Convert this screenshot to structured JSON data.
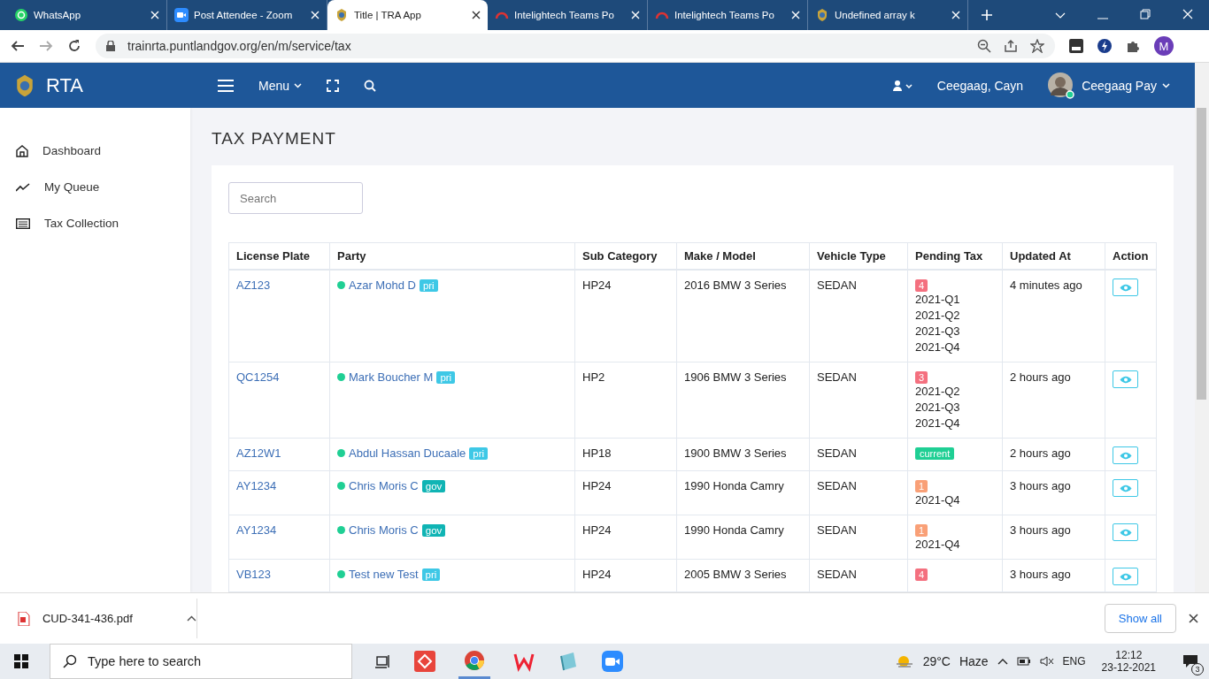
{
  "browser": {
    "tabs": [
      {
        "title": "WhatsApp",
        "kind": "chat",
        "selected": false
      },
      {
        "title": "Post Attendee - Zoom",
        "kind": "camera",
        "selected": false
      },
      {
        "title": "Title | TRA App",
        "kind": "emblem",
        "selected": true
      },
      {
        "title": "Intelightech Teams Po",
        "kind": "headset",
        "selected": false
      },
      {
        "title": "Intelightech Teams Po",
        "kind": "headset",
        "selected": false
      },
      {
        "title": "Undefined array k",
        "kind": "emblem",
        "selected": false
      }
    ],
    "url": "trainrta.puntlandgov.org/en/m/service/tax",
    "profile_initial": "M"
  },
  "header": {
    "brand": "RTA",
    "menu_label": "Menu",
    "user_name": "Ceegaag, Cayn",
    "account_name": "Ceegaag Pay"
  },
  "sidebar": {
    "items": [
      {
        "label": "Dashboard"
      },
      {
        "label": "My Queue"
      },
      {
        "label": "Tax Collection"
      }
    ]
  },
  "page": {
    "title": "TAX PAYMENT",
    "search": {
      "placeholder": "Search"
    }
  },
  "table": {
    "columns": [
      "License Plate",
      "Party",
      "Sub Category",
      "Make / Model",
      "Vehicle Type",
      "Pending Tax",
      "Updated At",
      "Action"
    ],
    "rows": [
      {
        "plate": "AZ123",
        "party": "Azar Mohd D",
        "tag": {
          "text": "pri",
          "color": "#3ec8e6"
        },
        "sub_category": "HP24",
        "make_model": "2016 BMW 3 Series",
        "vehicle_type": "SEDAN",
        "pending": {
          "kind": "count",
          "text": "4",
          "color": "#f4707f"
        },
        "quarters": [
          "2021-Q1",
          "2021-Q2",
          "2021-Q3",
          "2021-Q4"
        ],
        "updated": "4 minutes ago"
      },
      {
        "plate": "QC1254",
        "party": "Mark Boucher M",
        "tag": {
          "text": "pri",
          "color": "#3ec8e6"
        },
        "sub_category": "HP2",
        "make_model": "1906 BMW 3 Series",
        "vehicle_type": "SEDAN",
        "pending": {
          "kind": "count",
          "text": "3",
          "color": "#f4707f"
        },
        "quarters": [
          "2021-Q2",
          "2021-Q3",
          "2021-Q4"
        ],
        "updated": "2 hours ago"
      },
      {
        "plate": "AZ12W1",
        "party": "Abdul Hassan Ducaale",
        "tag": {
          "text": "pri",
          "color": "#3ec8e6"
        },
        "sub_category": "HP18",
        "make_model": "1900 BMW 3 Series",
        "vehicle_type": "SEDAN",
        "pending": {
          "kind": "status",
          "text": "current",
          "color": "#1fcf94"
        },
        "quarters": [],
        "updated": "2 hours ago"
      },
      {
        "plate": "AY1234",
        "party": "Chris Moris C",
        "tag": {
          "text": "gov",
          "color": "#10b4b4"
        },
        "sub_category": "HP24",
        "make_model": "1990 Honda Camry",
        "vehicle_type": "SEDAN",
        "pending": {
          "kind": "count",
          "text": "1",
          "color": "#f9a077"
        },
        "quarters": [
          "2021-Q4"
        ],
        "updated": "3 hours ago"
      },
      {
        "plate": "AY1234",
        "party": "Chris Moris C",
        "tag": {
          "text": "gov",
          "color": "#10b4b4"
        },
        "sub_category": "HP24",
        "make_model": "1990 Honda Camry",
        "vehicle_type": "SEDAN",
        "pending": {
          "kind": "count",
          "text": "1",
          "color": "#f9a077"
        },
        "quarters": [
          "2021-Q4"
        ],
        "updated": "3 hours ago"
      },
      {
        "plate": "VB123",
        "party": "Test new Test",
        "tag": {
          "text": "pri",
          "color": "#3ec8e6"
        },
        "sub_category": "HP24",
        "make_model": "2005 BMW 3 Series",
        "vehicle_type": "SEDAN",
        "pending": {
          "kind": "count",
          "text": "4",
          "color": "#f4707f"
        },
        "quarters": [],
        "updated": "3 hours ago"
      }
    ]
  },
  "download_bar": {
    "file": "CUD-341-436.pdf",
    "show_all": "Show all"
  },
  "taskbar": {
    "search_placeholder": "Type here to search",
    "weather": "29°C",
    "condition": "Haze",
    "language": "ENG",
    "time": "12:12",
    "date": "23-12-2021",
    "notifications": "3"
  }
}
